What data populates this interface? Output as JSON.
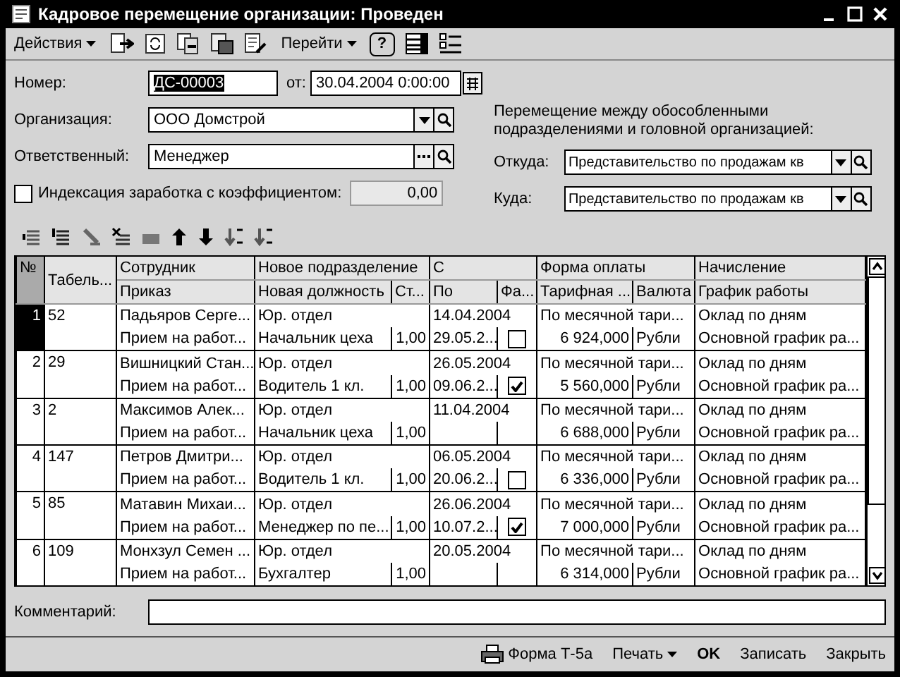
{
  "window": {
    "title": "Кадровое перемещение организации: Проведен"
  },
  "toolbar": {
    "actions_menu": "Действия",
    "goto_menu": "Перейти",
    "help": "?"
  },
  "form": {
    "number_label": "Номер:",
    "number": "ДС-00003",
    "date_label": "от:",
    "date": "30.04.2004  0:00:00",
    "org_label": "Организация:",
    "org": "ООО Домстрой",
    "resp_label": "Ответственный:",
    "resp": "Менеджер",
    "index_label": "Индексация заработка с коэффициентом:",
    "index_checked": false,
    "index_value": "0,00",
    "transfer_note": "Перемещение между обособленными подразделениями и головной организацией:",
    "from_label": "Откуда:",
    "from": "Представительство по продажам кв",
    "to_label": "Куда:",
    "to": "Представительство по продажам кв"
  },
  "table": {
    "header": {
      "num": "№",
      "tab": "Табель...",
      "employee": "Сотрудник",
      "order": "Приказ",
      "dept": "Новое подразделение",
      "position": "Новая должность",
      "rate": "Ст...",
      "from": "С",
      "to": "По",
      "fact": "Фа...",
      "pay": "Форма оплаты",
      "tariff": "Тарифная ...",
      "currency": "Валюта",
      "accrual": "Начисление",
      "schedule": "График работы"
    },
    "rows": [
      {
        "n": "1",
        "tab": "52",
        "employee": "Падьяров Серге...",
        "order": "Прием на работ...",
        "dept": "Юр. отдел",
        "position": "Начальник цеха",
        "rate": "1,00",
        "from": "14.04.2004",
        "to": "29.05.2...",
        "fact": false,
        "pay": "По месячной тари...",
        "tariff": "6 924,000",
        "currency": "Рубли",
        "accrual": "Оклад по дням",
        "schedule": "Основной график ра...",
        "selected": true
      },
      {
        "n": "2",
        "tab": "29",
        "employee": "Вишницкий Стан...",
        "order": "Прием на работ...",
        "dept": "Юр. отдел",
        "position": "Водитель 1 кл.",
        "rate": "1,00",
        "from": "26.05.2004",
        "to": "09.06.2...",
        "fact": true,
        "pay": "По месячной тари...",
        "tariff": "5 560,000",
        "currency": "Рубли",
        "accrual": "Оклад по дням",
        "schedule": "Основной график ра...",
        "selected": false
      },
      {
        "n": "3",
        "tab": "2",
        "employee": "Максимов Алек...",
        "order": "Прием на работ...",
        "dept": "Юр. отдел",
        "position": "Начальник цеха",
        "rate": "1,00",
        "from": "11.04.2004",
        "pay": "По месячной тари...",
        "tariff": "6 688,000",
        "currency": "Рубли",
        "accrual": "Оклад по дням",
        "schedule": "Основной график ра...",
        "selected": false
      },
      {
        "n": "4",
        "tab": "147",
        "employee": "Петров Дмитри...",
        "order": "Прием на работ...",
        "dept": "Юр. отдел",
        "position": "Водитель 1 кл.",
        "rate": "1,00",
        "from": "06.05.2004",
        "to": "20.06.2...",
        "fact": false,
        "pay": "По месячной тари...",
        "tariff": "6 336,000",
        "currency": "Рубли",
        "accrual": "Оклад по дням",
        "schedule": "Основной график ра...",
        "selected": false
      },
      {
        "n": "5",
        "tab": "85",
        "employee": "Матавин Михаи...",
        "order": "Прием на работ...",
        "dept": "Юр. отдел",
        "position": "Менеджер по пе...",
        "rate": "1,00",
        "from": "26.06.2004",
        "to": "10.07.2...",
        "fact": true,
        "pay": "По месячной тари...",
        "tariff": "7 000,000",
        "currency": "Рубли",
        "accrual": "Оклад по дням",
        "schedule": "Основной график ра...",
        "selected": false
      },
      {
        "n": "6",
        "tab": "109",
        "employee": "Монхзул Семен ...",
        "order": "Прием на работ...",
        "dept": "Юр. отдел",
        "position": "Бухгалтер",
        "rate": "1,00",
        "from": "20.05.2004",
        "pay": "По месячной тари...",
        "tariff": "6 314,000",
        "currency": "Рубли",
        "accrual": "Оклад по дням",
        "schedule": "Основной график ра...",
        "selected": false
      }
    ]
  },
  "comment": {
    "label": "Комментарий:"
  },
  "footer": {
    "print_form": "Форма Т-5а",
    "print_menu": "Печать",
    "ok": "OK",
    "save": "Записать",
    "close": "Закрыть"
  }
}
